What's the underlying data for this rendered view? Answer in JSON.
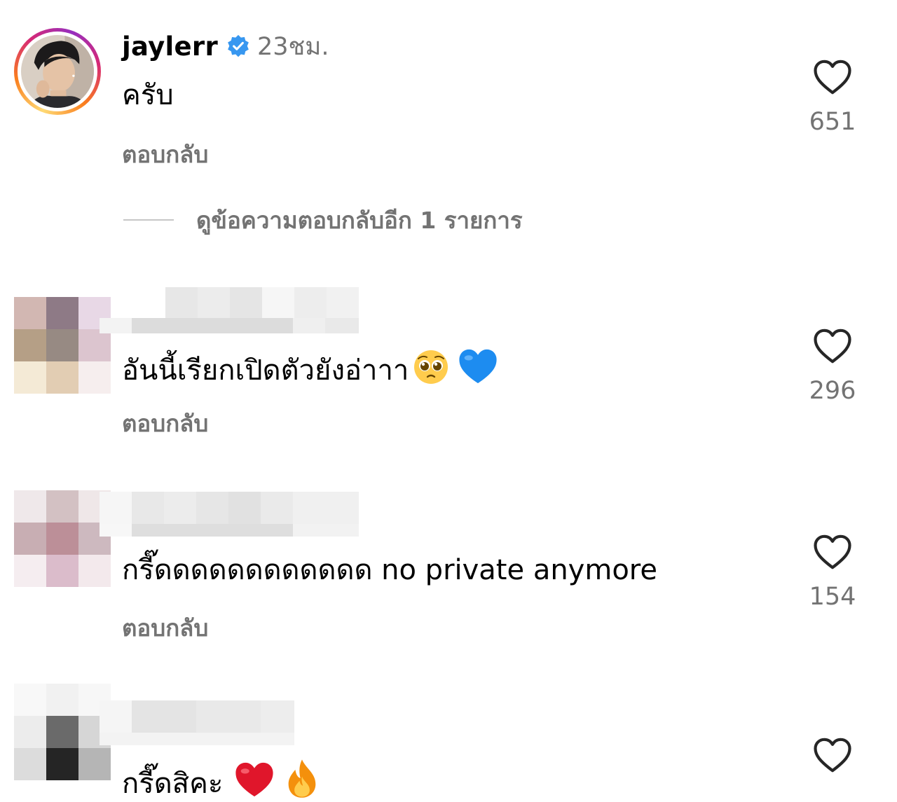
{
  "main_comment": {
    "username": "jaylerr",
    "time": "23ชม.",
    "text": "ครับ",
    "reply_label": "ตอบกลับ",
    "like_count": "651",
    "view_replies": "ดูข้อความตอบกลับอีก 1 รายการ"
  },
  "comments": [
    {
      "text": "อันนี้เรียกเปิดตัวยังอ่าาา",
      "emojis": [
        "pleading-face",
        "blue-heart"
      ],
      "reply_label": "ตอบกลับ",
      "like_count": "296"
    },
    {
      "text": "กรี๊ดดดดดดดดดดดด no private anymore",
      "emojis": [],
      "reply_label": "ตอบกลับ",
      "like_count": "154"
    },
    {
      "text": "กรี๊ดสิคะ",
      "emojis": [
        "red-heart",
        "fire"
      ],
      "reply_label": "",
      "like_count": ""
    }
  ],
  "colors": {
    "secondary_text": "#737373",
    "verified_badge": "#3797f0",
    "story_ring": [
      "#feda75",
      "#fa7e1e",
      "#d62976",
      "#962fbf"
    ]
  },
  "icons": [
    "verified-badge-icon",
    "heart-outline-icon"
  ]
}
